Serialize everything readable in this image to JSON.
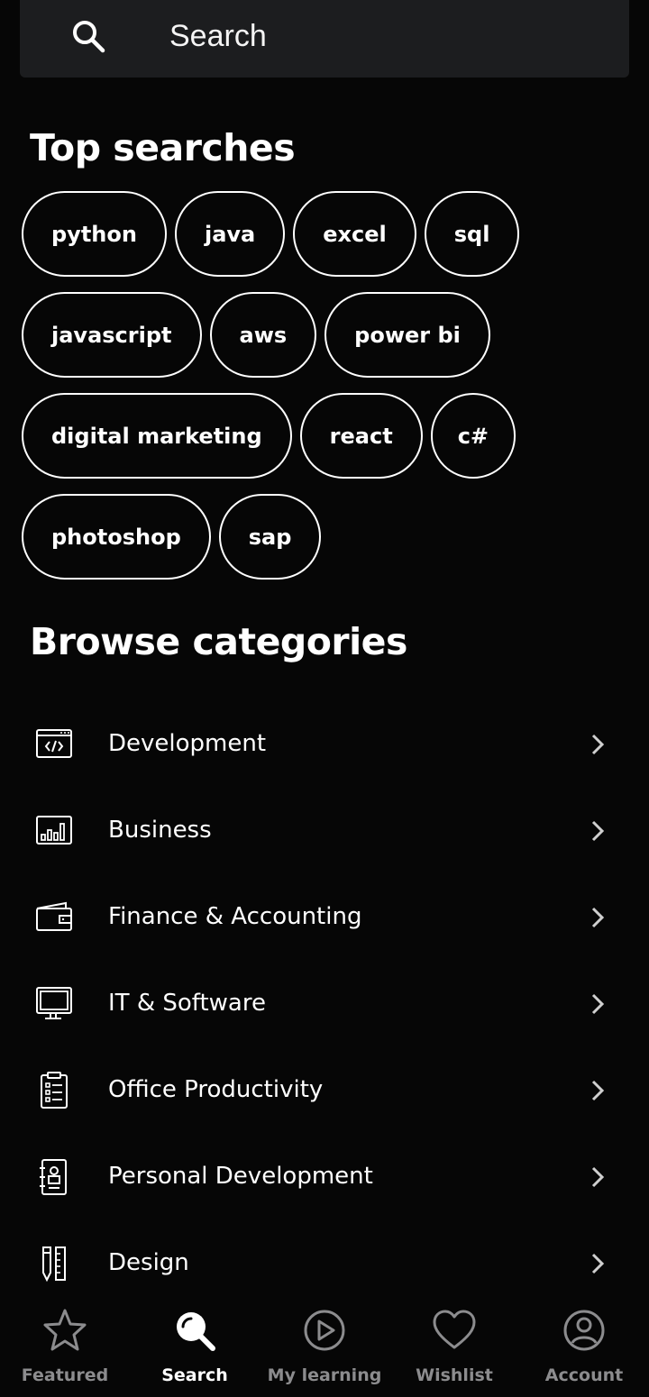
{
  "search": {
    "placeholder": "Search",
    "icon": "search-icon"
  },
  "top_searches": {
    "title": "Top searches",
    "rows": [
      [
        "python",
        "java",
        "excel",
        "sql"
      ],
      [
        "javascript",
        "aws",
        "power bi"
      ],
      [
        "digital marketing",
        "react",
        "c#"
      ],
      [
        "photoshop",
        "sap"
      ]
    ]
  },
  "browse": {
    "title": "Browse categories",
    "items": [
      {
        "label": "Development",
        "icon": "code-window-icon"
      },
      {
        "label": "Business",
        "icon": "bar-chart-icon"
      },
      {
        "label": "Finance & Accounting",
        "icon": "wallet-icon"
      },
      {
        "label": "IT & Software",
        "icon": "monitor-icon"
      },
      {
        "label": "Office Productivity",
        "icon": "clipboard-list-icon"
      },
      {
        "label": "Personal Development",
        "icon": "person-notebook-icon"
      },
      {
        "label": "Design",
        "icon": "pencil-ruler-icon"
      }
    ]
  },
  "nav": {
    "items": [
      {
        "label": "Featured",
        "icon": "star-icon",
        "active": false
      },
      {
        "label": "Search",
        "icon": "search-icon",
        "active": true
      },
      {
        "label": "My learning",
        "icon": "play-circle-icon",
        "active": false
      },
      {
        "label": "Wishlist",
        "icon": "heart-icon",
        "active": false
      },
      {
        "label": "Account",
        "icon": "user-circle-icon",
        "active": false
      }
    ]
  },
  "colors": {
    "background": "#060606",
    "search_bar": "#1c1d1f",
    "text": "#ffffff",
    "nav_inactive": "#8c8c8e"
  }
}
